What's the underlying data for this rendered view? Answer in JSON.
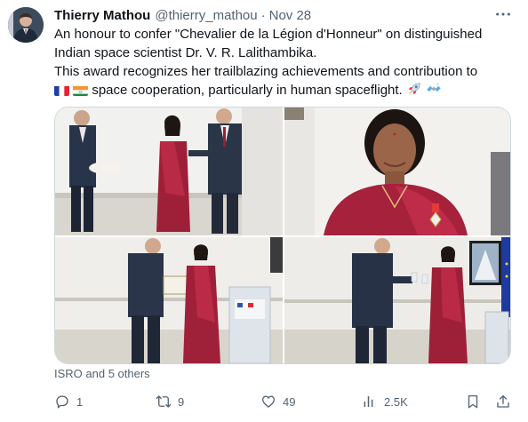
{
  "tweet": {
    "author_name": "Thierry Mathou",
    "handle": "@thierry_mathou",
    "separator": "·",
    "date": "Nov 28",
    "lines": [
      "An honour to confer \"Chevalier de la Légion d'Honneur\" on distinguished",
      "Indian space scientist Dr. V. R. Lalithambika.",
      "This award recognizes her trailblazing achievements and contribution to",
      "space cooperation, particularly in human spaceflight."
    ],
    "flags": [
      "france-flag",
      "india-flag"
    ],
    "trailing_emojis": [
      "rocket-icon",
      "satellite-icon"
    ],
    "liked_by": "ISRO and 5 others"
  },
  "actions": {
    "reply_count": "1",
    "retweet_count": "9",
    "like_count": "49",
    "views_count": "2.5K"
  },
  "photos": [
    {
      "name": "photo-award-presentation"
    },
    {
      "name": "photo-lalithambika-portrait"
    },
    {
      "name": "photo-certificate-handover"
    },
    {
      "name": "photo-toast"
    }
  ],
  "colors": {
    "text": "#0f1419",
    "secondary": "#536471",
    "border": "#cfd9de"
  }
}
